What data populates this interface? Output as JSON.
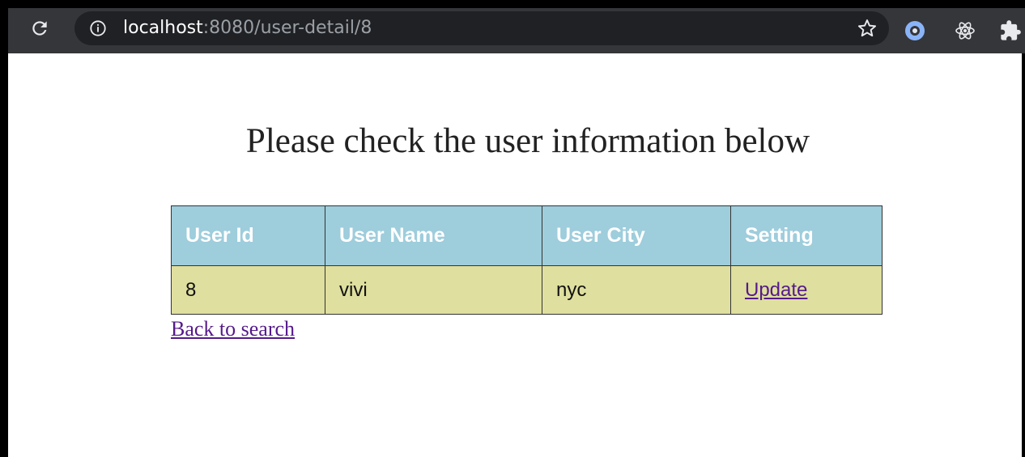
{
  "browser": {
    "url_host": "localhost",
    "url_path": ":8080/user-detail/8",
    "icons": {
      "reload": "reload-icon",
      "info": "info-icon",
      "bookmark": "star-icon",
      "extension1": "circle-extension-icon",
      "extension2": "react-devtools-icon",
      "extensions": "puzzle-icon"
    }
  },
  "page": {
    "title": "Please check the user information below",
    "table": {
      "headers": [
        "User Id",
        "User Name",
        "User City",
        "Setting"
      ],
      "rows": [
        {
          "id": "8",
          "name": "vivi",
          "city": "nyc",
          "action": "Update"
        }
      ]
    },
    "back_link": "Back to search"
  },
  "colors": {
    "header_bg": "#9ecddc",
    "row_bg": "#dfdf9f",
    "link": "#551a8b",
    "toolbar_bg": "#35363a"
  }
}
